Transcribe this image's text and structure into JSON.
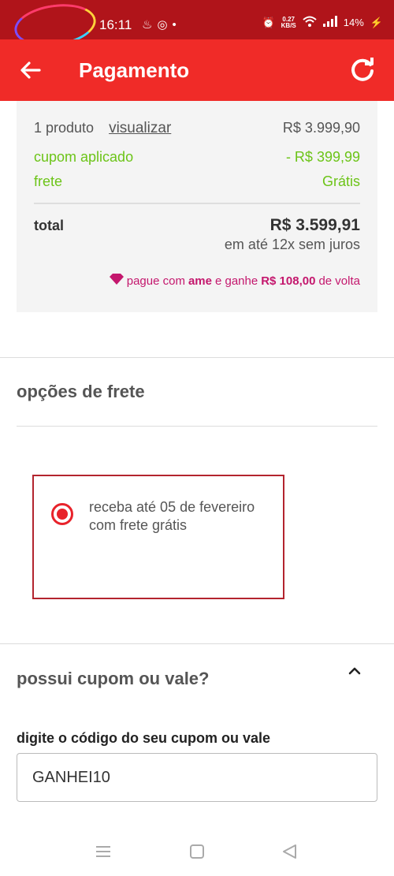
{
  "status_bar": {
    "time": "16:11",
    "icons_left": [
      "fire-icon",
      "instagram-icon",
      "dot-icon"
    ],
    "net_speed_value": "0.27",
    "net_speed_unit": "KB/S",
    "battery": "14%",
    "icons_right": [
      "alarm-icon",
      "wifi-icon",
      "signal-icon",
      "battery-charging-icon"
    ]
  },
  "app_bar": {
    "title": "Pagamento",
    "back_icon": "arrow-left-icon",
    "refresh_icon": "refresh-icon",
    "color": "#f02b28"
  },
  "summary": {
    "products_label": "1 produto",
    "view_link": "visualizar",
    "products_value": "R$ 3.999,90",
    "coupon_label": "cupom aplicado",
    "coupon_value": "- R$ 399,99",
    "shipping_label": "frete",
    "shipping_value": "Grátis",
    "total_label": "total",
    "total_value": "R$ 3.599,91",
    "installments": "em até 12x sem juros",
    "ame_prefix": "pague com",
    "ame_brand": "ame",
    "ame_middle": "e ganhe",
    "ame_amount": "R$ 108,00",
    "ame_suffix": "de volta"
  },
  "shipping_options": {
    "title": "opções de frete",
    "option_text": "receba até 05 de fevereiro com frete grátis",
    "selected": true
  },
  "coupon": {
    "title": "possui cupom ou vale?",
    "field_label": "digite o código do seu cupom ou vale",
    "value": "GANHEI10"
  },
  "colors": {
    "accent": "#f02b28",
    "status_bar": "#b0141a",
    "green": "#6cc418",
    "ame": "#c4176d"
  }
}
